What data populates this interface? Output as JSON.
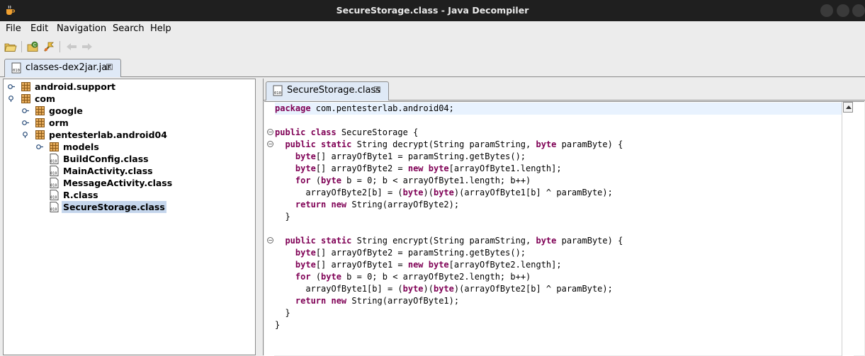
{
  "window": {
    "title": "SecureStorage.class - Java Decompiler"
  },
  "menu": [
    "File",
    "Edit",
    "Navigation",
    "Search",
    "Help"
  ],
  "toolbar": [
    "open-file-icon",
    "open-type-icon",
    "search-icon",
    "back-arrow-icon",
    "forward-arrow-icon"
  ],
  "jar_tab": {
    "label": "classes-dex2jar.jar",
    "close": "☒"
  },
  "tree": [
    {
      "label": "android.support",
      "type": "package"
    },
    {
      "label": "com",
      "type": "package"
    },
    {
      "label": "google",
      "type": "package"
    },
    {
      "label": "orm",
      "type": "package"
    },
    {
      "label": "pentesterlab.android04",
      "type": "package"
    },
    {
      "label": "models",
      "type": "package"
    },
    {
      "label": "BuildConfig.class",
      "type": "class"
    },
    {
      "label": "MainActivity.class",
      "type": "class"
    },
    {
      "label": "MessageActivity.class",
      "type": "class"
    },
    {
      "label": "R.class",
      "type": "class"
    },
    {
      "label": "SecureStorage.class",
      "type": "class",
      "selected": true
    }
  ],
  "code_tab": {
    "label": "SecureStorage.class",
    "close": "☒"
  },
  "code": [
    [
      [
        "kw",
        "package"
      ],
      [
        "t",
        " com.pentesterlab.android04;"
      ]
    ],
    [],
    [
      [
        "kw",
        "public class"
      ],
      [
        "t",
        " SecureStorage {"
      ]
    ],
    [
      [
        "t",
        "  "
      ],
      [
        "kw",
        "public static"
      ],
      [
        "t",
        " String decrypt(String paramString, "
      ],
      [
        "kw",
        "byte"
      ],
      [
        "t",
        " paramByte) {"
      ]
    ],
    [
      [
        "t",
        "    "
      ],
      [
        "kw",
        "byte"
      ],
      [
        "t",
        "[] arrayOfByte1 = paramString.getBytes();"
      ]
    ],
    [
      [
        "t",
        "    "
      ],
      [
        "kw",
        "byte"
      ],
      [
        "t",
        "[] arrayOfByte2 = "
      ],
      [
        "kw",
        "new byte"
      ],
      [
        "t",
        "[arrayOfByte1.length];"
      ]
    ],
    [
      [
        "t",
        "    "
      ],
      [
        "kw",
        "for"
      ],
      [
        "t",
        " ("
      ],
      [
        "kw",
        "byte"
      ],
      [
        "t",
        " b = 0; b < arrayOfByte1.length; b++)"
      ]
    ],
    [
      [
        "t",
        "      arrayOfByte2[b] = ("
      ],
      [
        "kw",
        "byte"
      ],
      [
        "t",
        ")("
      ],
      [
        "kw",
        "byte"
      ],
      [
        "t",
        ")(arrayOfByte1[b] ^ paramByte);"
      ]
    ],
    [
      [
        "t",
        "    "
      ],
      [
        "kw",
        "return new"
      ],
      [
        "t",
        " String(arrayOfByte2);"
      ]
    ],
    [
      [
        "t",
        "  }"
      ]
    ],
    [],
    [
      [
        "t",
        "  "
      ],
      [
        "kw",
        "public static"
      ],
      [
        "t",
        " String encrypt(String paramString, "
      ],
      [
        "kw",
        "byte"
      ],
      [
        "t",
        " paramByte) {"
      ]
    ],
    [
      [
        "t",
        "    "
      ],
      [
        "kw",
        "byte"
      ],
      [
        "t",
        "[] arrayOfByte2 = paramString.getBytes();"
      ]
    ],
    [
      [
        "t",
        "    "
      ],
      [
        "kw",
        "byte"
      ],
      [
        "t",
        "[] arrayOfByte1 = "
      ],
      [
        "kw",
        "new byte"
      ],
      [
        "t",
        "[arrayOfByte2.length];"
      ]
    ],
    [
      [
        "t",
        "    "
      ],
      [
        "kw",
        "for"
      ],
      [
        "t",
        " ("
      ],
      [
        "kw",
        "byte"
      ],
      [
        "t",
        " b = 0; b < arrayOfByte2.length; b++)"
      ]
    ],
    [
      [
        "t",
        "      arrayOfByte1[b] = ("
      ],
      [
        "kw",
        "byte"
      ],
      [
        "t",
        ")("
      ],
      [
        "kw",
        "byte"
      ],
      [
        "t",
        ")(arrayOfByte2[b] ^ paramByte);"
      ]
    ],
    [
      [
        "t",
        "    "
      ],
      [
        "kw",
        "return new"
      ],
      [
        "t",
        " String(arrayOfByte1);"
      ]
    ],
    [
      [
        "t",
        "  }"
      ]
    ],
    [
      [
        "t",
        "}"
      ]
    ]
  ],
  "colors": {
    "keyword": "#7f0055",
    "selection": "#c5d6ec",
    "current_line": "#e8f2fe",
    "titlebar": "#1f1f1f"
  }
}
